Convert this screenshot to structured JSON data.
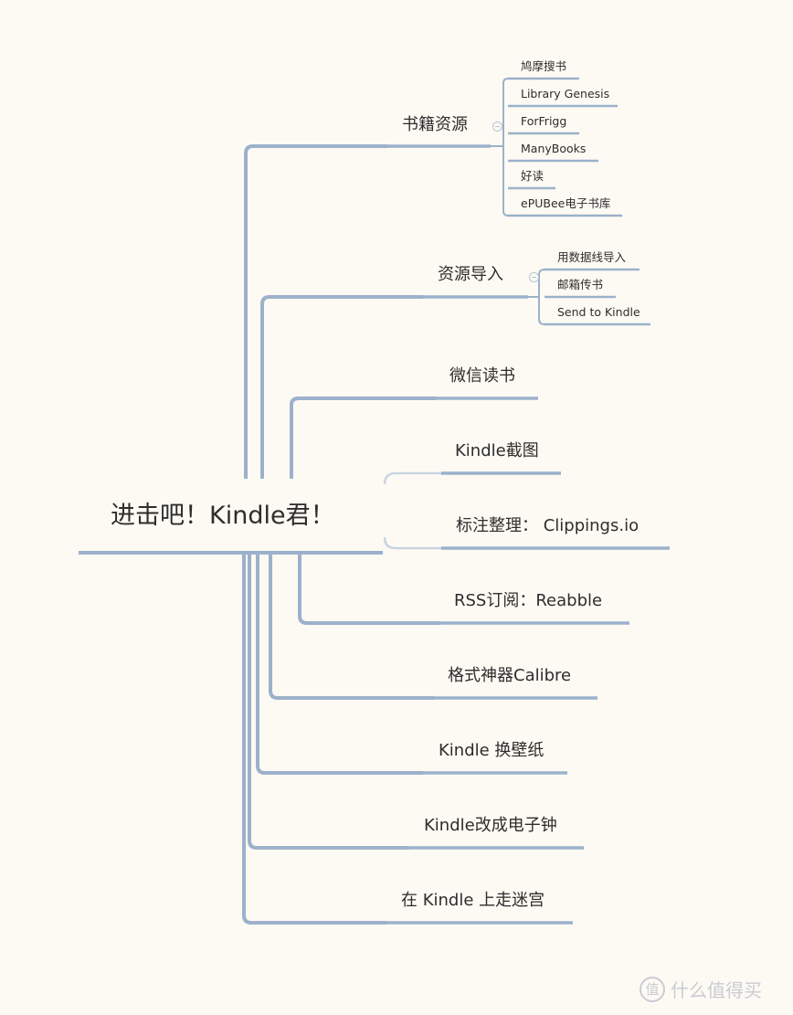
{
  "root": {
    "label": "进击吧！Kindle君！"
  },
  "branches": [
    {
      "label": "书籍资源",
      "children": [
        "鸠摩搜书",
        "Library Genesis",
        "ForFrigg",
        "ManyBooks",
        "好读",
        "ePUBee电子书库"
      ]
    },
    {
      "label": "资源导入",
      "children": [
        "用数据线导入",
        "邮箱传书",
        "Send to Kindle"
      ]
    },
    {
      "label": "微信读书"
    },
    {
      "label": "Kindle截图"
    },
    {
      "label": "标注整理：  Clippings.io"
    },
    {
      "label": "RSS订阅：Reabble"
    },
    {
      "label": "格式神器Calibre"
    },
    {
      "label": "Kindle 换壁纸"
    },
    {
      "label": "Kindle改成电子钟"
    },
    {
      "label": "在 Kindle 上走迷宫"
    }
  ],
  "colors": {
    "line": "#9cb1cb",
    "line_light": "#c9d4e1",
    "background": "#fdfaf3",
    "text": "#2d2d2d"
  },
  "watermark": {
    "icon_char": "值",
    "text": "什么值得买"
  }
}
